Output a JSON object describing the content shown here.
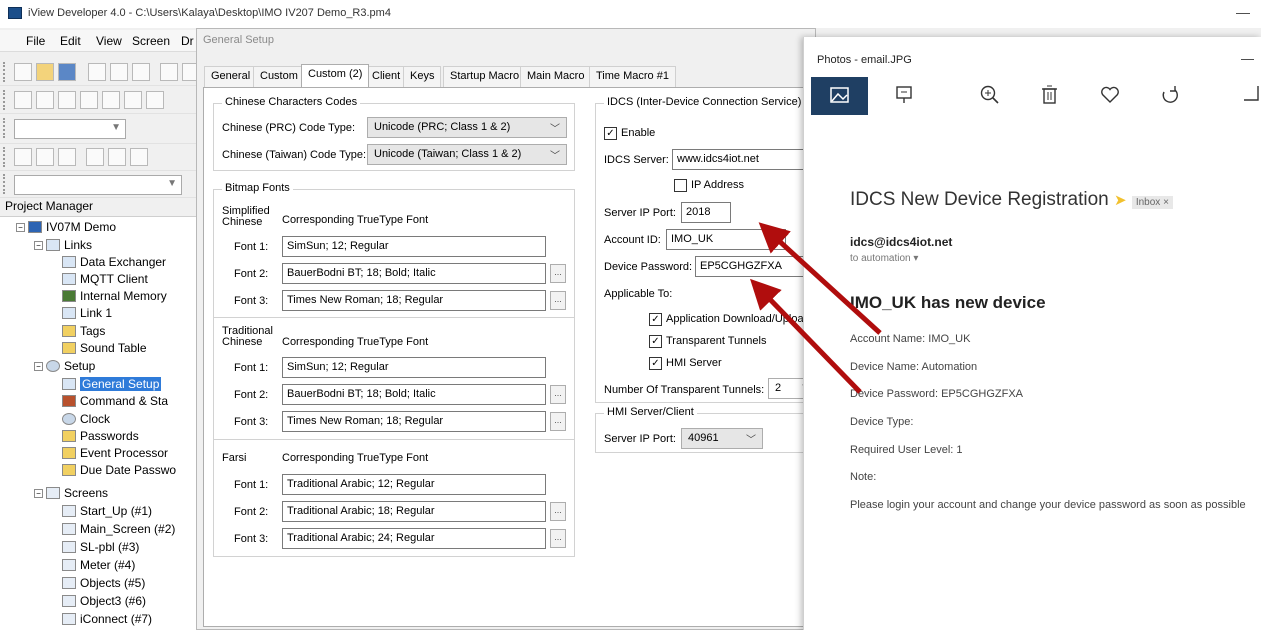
{
  "window": {
    "title": "iView Developer 4.0 - C:\\Users\\Kalaya\\Desktop\\IMO IV207 Demo_R3.pm4",
    "minimize_glyph": "—"
  },
  "menu": {
    "file": "File",
    "edit": "Edit",
    "view": "View",
    "screen": "Screen",
    "draw": "Dr"
  },
  "project_manager": {
    "title": "Project Manager",
    "root": "IV07M Demo",
    "links": "Links",
    "link_items": [
      "Data Exchanger",
      "MQTT Client",
      "Internal Memory",
      "Link 1"
    ],
    "tags": "Tags",
    "sound_table": "Sound Table",
    "setup": "Setup",
    "setup_items": [
      "General Setup",
      "Command & Sta",
      "Clock",
      "Passwords",
      "Event Processor",
      "Due Date Passwo"
    ],
    "screens": "Screens",
    "screen_items": [
      "Start_Up (#1)",
      "Main_Screen (#2)",
      "SL-pbl (#3)",
      "Meter (#4)",
      "Objects (#5)",
      "Object3 (#6)",
      "iConnect (#7)"
    ]
  },
  "dialog": {
    "title": "General Setup",
    "tabs": [
      "General",
      "Custom",
      "Custom (2)",
      "Client",
      "Keys",
      "Startup Macro",
      "Main Macro",
      "Time Macro #1"
    ],
    "chinese_codes": {
      "title": "Chinese Characters Codes",
      "prc_label": "Chinese (PRC) Code Type:",
      "prc_value": "Unicode (PRC; Class 1 & 2)",
      "taiwan_label": "Chinese (Taiwan) Code Type:",
      "taiwan_value": "Unicode (Taiwan; Class 1 & 2)"
    },
    "bitmap_fonts": {
      "title": "Bitmap Fonts",
      "corresponding": "Corresponding TrueType Font",
      "groups": [
        {
          "name": "Simplified Chinese",
          "fonts": [
            "SimSun; 12; Regular",
            "BauerBodni BT; 18; Bold; Italic",
            "Times New Roman; 18; Regular"
          ]
        },
        {
          "name": "Traditional Chinese",
          "fonts": [
            "SimSun; 12; Regular",
            "BauerBodni BT; 18; Bold; Italic",
            "Times New Roman; 18; Regular"
          ]
        },
        {
          "name": "Farsi",
          "fonts": [
            "Traditional Arabic; 12; Regular",
            "Traditional Arabic; 18; Regular",
            "Traditional Arabic; 24; Regular"
          ]
        }
      ],
      "font_labels": [
        "Font 1:",
        "Font 2:",
        "Font 3:"
      ],
      "ellipsis": "..."
    },
    "idcs": {
      "title": "IDCS (Inter-Device Connection Service)",
      "enable": "Enable",
      "server_label": "IDCS Server:",
      "server_value": "www.idcs4iot.net",
      "ip_address": "IP Address",
      "port_label": "Server IP Port:",
      "port_value": "2018",
      "account_label": "Account ID:",
      "account_value": "IMO_UK",
      "password_label": "Device Password:",
      "password_value": "EP5CGHGZFXA",
      "applicable": "Applicable To:",
      "app_download": "Application Download/Upload",
      "tunnels": "Transparent Tunnels",
      "hmi_server": "HMI Server",
      "num_tunnels_label": "Number Of Transparent Tunnels:",
      "num_tunnels_value": "2"
    },
    "hmi_client": {
      "title": "HMI Server/Client",
      "port_label": "Server IP Port:",
      "port_value": "40961"
    }
  },
  "photos": {
    "title": "Photos - email.JPG",
    "minimize_glyph": "—",
    "email": {
      "subject": "IDCS New Device Registration",
      "inbox": "Inbox ×",
      "sender": "idcs@idcs4iot.net",
      "to": "to automation ▾",
      "headline": "IMO_UK has new device",
      "lines": [
        "Account Name: IMO_UK",
        "Device Name: Automation",
        "Device Password: EP5CGHGZFXA",
        "Device Type:",
        "Required User Level: 1",
        "Note:",
        "Please login your account and change your device password as soon as possible"
      ]
    }
  },
  "colors": {
    "arrow": "#b00d0d",
    "selection": "#2f7bd9",
    "photos_home": "#1f3f63"
  }
}
